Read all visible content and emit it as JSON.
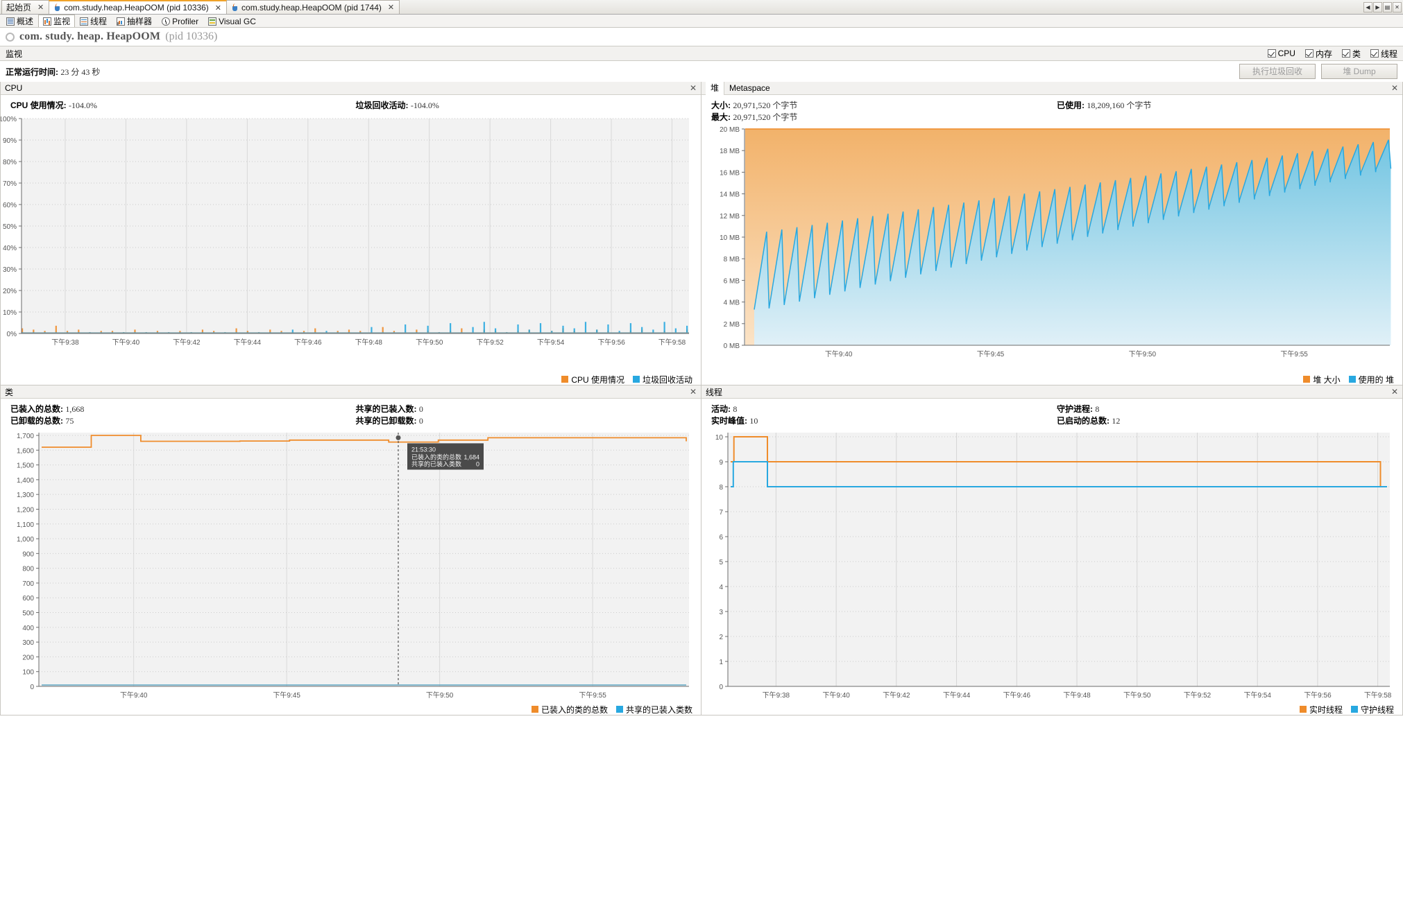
{
  "window": {
    "tabs": [
      {
        "label": "起始页",
        "icon": "none",
        "active": false,
        "closable": true
      },
      {
        "label": "com.study.heap.HeapOOM (pid 10336)",
        "icon": "java-icon",
        "active": true,
        "closable": true
      },
      {
        "label": "com.study.heap.HeapOOM (pid 1744)",
        "icon": "java-icon",
        "active": false,
        "closable": true
      }
    ],
    "tab_nav": [
      "◀",
      "▶",
      "▤",
      "✕"
    ]
  },
  "view_tabs": [
    {
      "label": "概述",
      "icon": "overview-icon",
      "active": false
    },
    {
      "label": "监视",
      "icon": "monitor-icon",
      "active": true
    },
    {
      "label": "线程",
      "icon": "threads-icon",
      "active": false
    },
    {
      "label": "抽样器",
      "icon": "sampler-icon",
      "active": false
    },
    {
      "label": "Profiler",
      "icon": "profiler-icon",
      "active": false
    },
    {
      "label": "Visual GC",
      "icon": "visualgc-icon",
      "active": false
    }
  ],
  "process": {
    "name": "com. study. heap. HeapOOM",
    "pid": "(pid 10336)"
  },
  "section": {
    "title": "监视",
    "checkboxes": [
      {
        "label": "CPU",
        "checked": true
      },
      {
        "label": "内存",
        "checked": true
      },
      {
        "label": "类",
        "checked": true
      },
      {
        "label": "线程",
        "checked": true
      }
    ]
  },
  "uptime": {
    "label": "正常运行时间:",
    "value": "23 分 43 秒"
  },
  "buttons": {
    "gc": "执行垃圾回收",
    "heapdump": "堆 Dump"
  },
  "cpu_panel": {
    "title": "CPU",
    "close": "✕",
    "stats": [
      {
        "label": "CPU 使用情况:",
        "value": "-104.0%"
      },
      {
        "label": "垃圾回收活动:",
        "value": "-104.0%"
      }
    ],
    "legend": [
      {
        "label": "CPU 使用情况",
        "color": "#ef8c2b"
      },
      {
        "label": "垃圾回收活动",
        "color": "#28a8e0"
      }
    ]
  },
  "heap_panel": {
    "title": "堆",
    "subtab": "Metaspace",
    "close": "✕",
    "stats": [
      {
        "label": "大小:",
        "value": "20,971,520 个字节"
      },
      {
        "label": "已使用:",
        "value": "18,209,160 个字节"
      },
      {
        "label": "最大:",
        "value": "20,971,520 个字节"
      }
    ],
    "legend": [
      {
        "label": "堆 大小",
        "color": "#ef8c2b"
      },
      {
        "label": "使用的 堆",
        "color": "#28a8e0"
      }
    ]
  },
  "classes_panel": {
    "title": "类",
    "close": "✕",
    "stats": [
      {
        "label": "已装入的总数:",
        "value": "1,668"
      },
      {
        "label": "共享的已装入数:",
        "value": "0"
      },
      {
        "label": "已卸载的总数:",
        "value": "75"
      },
      {
        "label": "共享的已卸载数:",
        "value": "0"
      }
    ],
    "tooltip": {
      "time": "21:53:30",
      "rows": [
        {
          "label": "已装入的类的总数",
          "value": "1,684"
        },
        {
          "label": "共享的已装入类数",
          "value": "0"
        }
      ]
    },
    "legend": [
      {
        "label": "已装入的类的总数",
        "color": "#ef8c2b"
      },
      {
        "label": "共享的已装入类数",
        "color": "#28a8e0"
      }
    ]
  },
  "threads_panel": {
    "title": "线程",
    "close": "✕",
    "stats": [
      {
        "label": "活动:",
        "value": "8"
      },
      {
        "label": "守护进程:",
        "value": "8"
      },
      {
        "label": "实时峰值:",
        "value": "10"
      },
      {
        "label": "已启动的总数:",
        "value": "12"
      }
    ],
    "legend": [
      {
        "label": "实时线程",
        "color": "#ef8c2b"
      },
      {
        "label": "守护线程",
        "color": "#28a8e0"
      }
    ]
  },
  "chart_data": [
    {
      "id": "cpu-chart",
      "type": "area",
      "title": "CPU",
      "ylabel": "",
      "ylim": [
        0,
        100
      ],
      "yticks": [
        "0%",
        "10%",
        "20%",
        "30%",
        "40%",
        "50%",
        "60%",
        "70%",
        "80%",
        "90%",
        "100%"
      ],
      "xticks": [
        "下午9:38",
        "下午9:40",
        "下午9:42",
        "下午9:44",
        "下午9:46",
        "下午9:48",
        "下午9:50",
        "下午9:52",
        "下午9:54",
        "下午9:56",
        "下午9:58"
      ],
      "grid": true,
      "legend_position": "bottom-right",
      "series": [
        {
          "name": "CPU 使用情况",
          "color": "#ef8c2b",
          "values": [
            0.4,
            0.3,
            0.2,
            0.6,
            0.2,
            0.3,
            0.1,
            0.2,
            0.2,
            0.1,
            0.3,
            0.1,
            0.2,
            0.1,
            0.2,
            0.1,
            0.3,
            0.2,
            0.1,
            0.4,
            0.2,
            0.1,
            0.3,
            0.2,
            0.1,
            0.2,
            0.4,
            0.1,
            0.2,
            0.3,
            0.2,
            0.1,
            0.5,
            0.2,
            0.1,
            0.3,
            0.2,
            0.1,
            0.2,
            0.4,
            0.1,
            0.3,
            0.2,
            0.1,
            0.2,
            0.3,
            0.1,
            0.2,
            0.4,
            0.2,
            0.1,
            0.3,
            0.2,
            0.1,
            0.2,
            0.3,
            0.1,
            0.2,
            0.1,
            0.3
          ]
        },
        {
          "name": "垃圾回收活动",
          "color": "#28a8e0",
          "values": [
            0.1,
            0.1,
            0.1,
            0.1,
            0.1,
            0.1,
            0.1,
            0.1,
            0.1,
            0.1,
            0.1,
            0.1,
            0.1,
            0.1,
            0.1,
            0.1,
            0.1,
            0.1,
            0.1,
            0.1,
            0.1,
            0.1,
            0.1,
            0.1,
            0.3,
            0.1,
            0.1,
            0.2,
            0.1,
            0.1,
            0.1,
            0.5,
            0.1,
            0.1,
            0.7,
            0.1,
            0.6,
            0.1,
            0.8,
            0.1,
            0.5,
            0.9,
            0.4,
            0.1,
            0.7,
            0.3,
            0.8,
            0.2,
            0.6,
            0.4,
            0.9,
            0.3,
            0.7,
            0.2,
            0.8,
            0.5,
            0.3,
            0.9,
            0.4,
            0.6
          ]
        }
      ]
    },
    {
      "id": "heap-chart",
      "type": "area",
      "title": "堆",
      "ylabel": "MB",
      "ylim": [
        0,
        20
      ],
      "yticks": [
        "0 MB",
        "2 MB",
        "4 MB",
        "6 MB",
        "8 MB",
        "10 MB",
        "12 MB",
        "14 MB",
        "16 MB",
        "18 MB",
        "20 MB"
      ],
      "xticks": [
        "下午9:40",
        "下午9:45",
        "下午9:50",
        "下午9:55"
      ],
      "grid": true,
      "legend_position": "bottom-right",
      "series": [
        {
          "name": "堆 大小",
          "color": "#ef8c2b",
          "constant": 20.0
        },
        {
          "name": "使用的 堆",
          "color": "#28a8e0",
          "sawtooth": {
            "start_peak": 10.5,
            "end_peak": 19.2,
            "start_trough": 3.3,
            "end_trough": 16.6,
            "cycles": 42
          }
        }
      ]
    },
    {
      "id": "classes-chart",
      "type": "line",
      "title": "类",
      "ylabel": "",
      "ylim": [
        0,
        1700
      ],
      "yticks": [
        "0",
        "100",
        "200",
        "300",
        "400",
        "500",
        "600",
        "700",
        "800",
        "900",
        "1,000",
        "1,100",
        "1,200",
        "1,300",
        "1,400",
        "1,500",
        "1,600",
        "1,700"
      ],
      "xticks": [
        "下午9:40",
        "下午9:45",
        "下午9:50",
        "下午9:55"
      ],
      "grid": true,
      "legend_position": "bottom-right",
      "series": [
        {
          "name": "已装入的类的总数",
          "color": "#ef8c2b",
          "values": [
            1620,
            1700,
            1660,
            1660,
            1662,
            1668,
            1668,
            1655,
            1668,
            1684,
            1684,
            1684,
            1684,
            1660
          ]
        },
        {
          "name": "共享的已装入类数",
          "color": "#28a8e0",
          "constant": 0
        }
      ]
    },
    {
      "id": "threads-chart",
      "type": "line",
      "title": "线程",
      "ylabel": "",
      "ylim": [
        0,
        10
      ],
      "yticks": [
        "0",
        "1",
        "2",
        "3",
        "4",
        "5",
        "6",
        "7",
        "8",
        "9",
        "10"
      ],
      "xticks": [
        "下午9:38",
        "下午9:40",
        "下午9:42",
        "下午9:44",
        "下午9:46",
        "下午9:48",
        "下午9:50",
        "下午9:52",
        "下午9:54",
        "下午9:56",
        "下午9:58"
      ],
      "grid": true,
      "legend_position": "bottom-right",
      "series": [
        {
          "name": "实时线程",
          "color": "#ef8c2b",
          "steps": [
            [
              0,
              9
            ],
            [
              0.5,
              10
            ],
            [
              5.5,
              10
            ],
            [
              5.6,
              9
            ],
            [
              96,
              9
            ],
            [
              99,
              8
            ],
            [
              100,
              8
            ]
          ]
        },
        {
          "name": "守护线程",
          "color": "#28a8e0",
          "steps": [
            [
              0,
              8
            ],
            [
              0.4,
              9
            ],
            [
              5.5,
              9
            ],
            [
              5.6,
              8
            ],
            [
              100,
              8
            ]
          ]
        }
      ]
    }
  ]
}
